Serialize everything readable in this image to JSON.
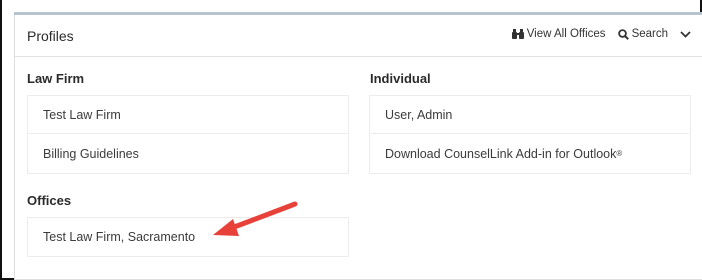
{
  "header": {
    "title": "Profiles",
    "view_all_offices": "View All Offices",
    "search": "Search"
  },
  "law_firm": {
    "title": "Law Firm",
    "items": [
      "Test Law Firm",
      "Billing Guidelines"
    ]
  },
  "individual": {
    "title": "Individual",
    "items": [
      "User, Admin",
      "Download CounselLink Add-in for Outlook"
    ],
    "registered_mark": "®"
  },
  "offices": {
    "title": "Offices",
    "items": [
      "Test Law Firm, Sacramento"
    ]
  },
  "colors": {
    "arrow": "#e8413a",
    "accent_rule": "#b7c4d0"
  },
  "icons": {
    "view_all_offices": "binoculars-icon",
    "search": "search-icon",
    "collapse": "chevron-down-icon"
  }
}
